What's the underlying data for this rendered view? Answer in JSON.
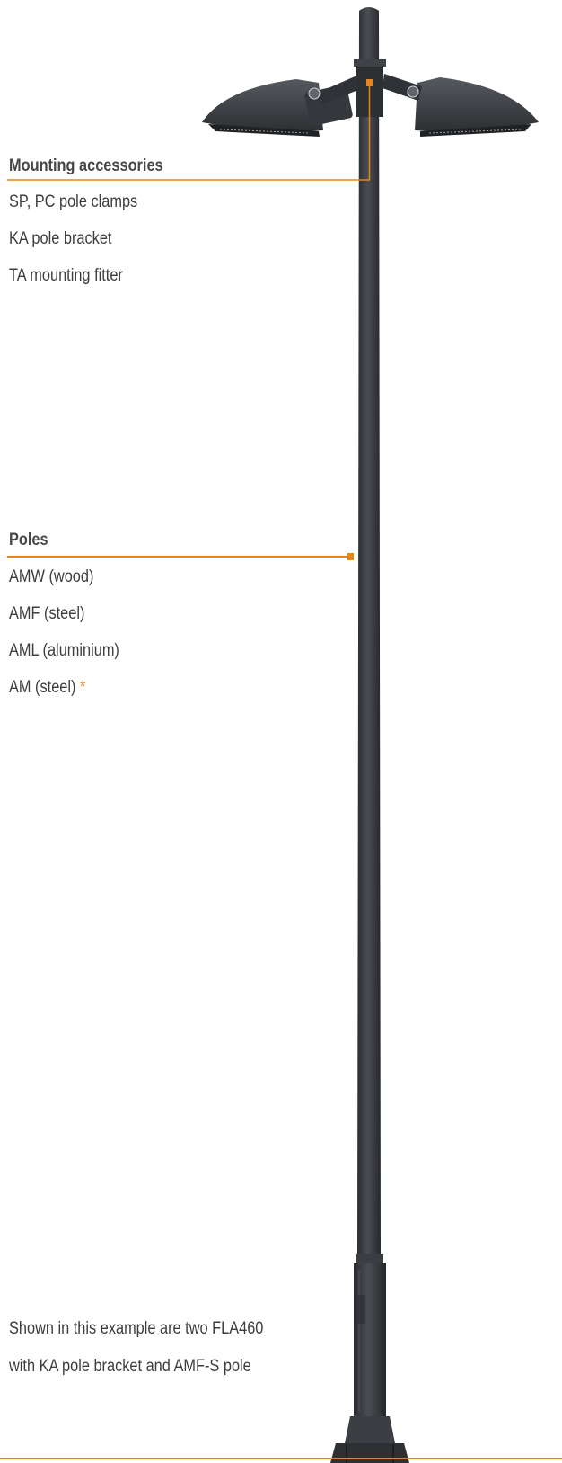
{
  "mounting": {
    "heading": "Mounting accessories",
    "items": [
      "SP, PC pole clamps",
      "KA pole bracket",
      "TA mounting fitter"
    ]
  },
  "poles": {
    "heading": "Poles",
    "items": [
      "AMW (wood)",
      "AMF (steel)",
      "AML (aluminium)",
      "AM (steel)"
    ],
    "footnote_mark": "*"
  },
  "caption": {
    "line1": "Shown in this example are two FLA460",
    "line2": "with KA pole bracket and AMF-S pole"
  },
  "colors": {
    "accent": "#e8841a",
    "pole": "#3c3f43",
    "text": "#3d3d3d"
  },
  "illustration": {
    "subject": "street-light-pole-with-two-luminaires"
  }
}
